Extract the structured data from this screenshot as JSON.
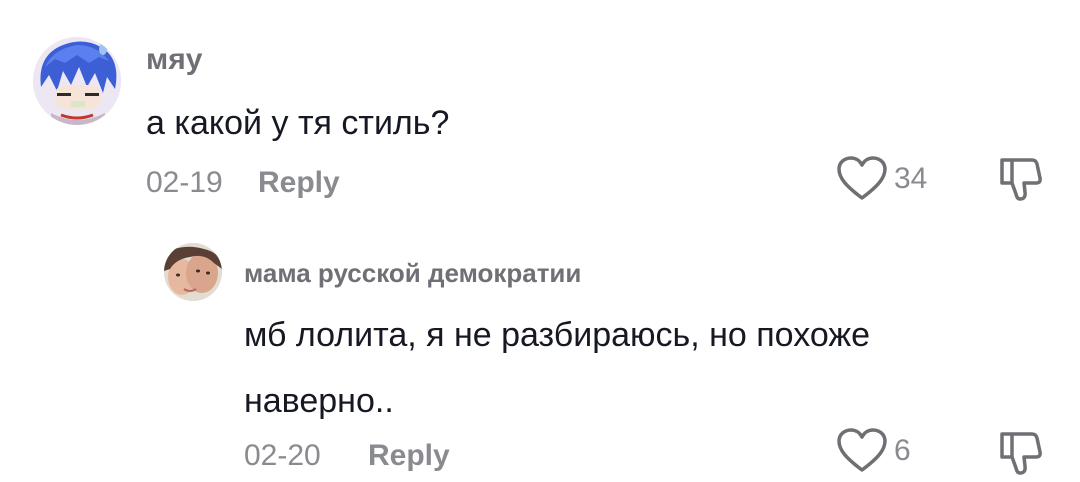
{
  "colors": {
    "username": "#6f6f75",
    "text": "#161823",
    "meta": "#8a8b91",
    "icon": "#6f6f75"
  },
  "comments": [
    {
      "username": "мяу",
      "text": "а какой у тя стиль?",
      "date": "02-19",
      "reply_label": "Reply",
      "likes": "34",
      "avatar_icon": "avatar-anime-icon"
    },
    {
      "username": "мама русской демократии",
      "text": "мб лолита, я не разбираюсь, но похоже наверно..",
      "date": "02-20",
      "reply_label": "Reply",
      "likes": "6",
      "avatar_icon": "avatar-photo-icon"
    }
  ]
}
